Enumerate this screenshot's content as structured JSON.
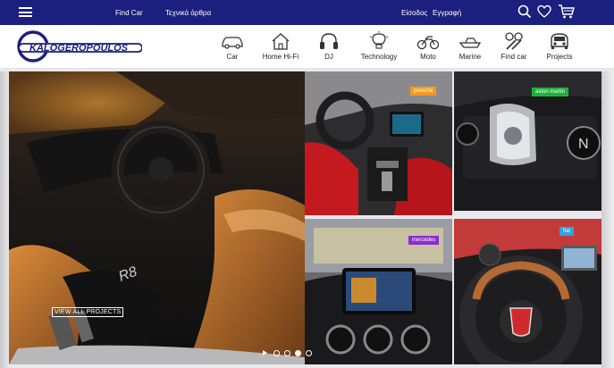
{
  "topbar": {
    "find_car": "Find Car",
    "articles": "Τεχνικά άρθρα",
    "login": "Είσοδος",
    "register": "Εγγραφή"
  },
  "logo": {
    "text": "KALOGEROPOULOS"
  },
  "nav": [
    {
      "label": "Car",
      "icon": "car-icon"
    },
    {
      "label": "Home Hi-Fi",
      "icon": "home-icon"
    },
    {
      "label": "DJ",
      "icon": "headphones-icon"
    },
    {
      "label": "Technology",
      "icon": "lightbulb-icon"
    },
    {
      "label": "Moto",
      "icon": "motorcycle-icon"
    },
    {
      "label": "Marine",
      "icon": "boat-icon"
    },
    {
      "label": "Find car",
      "icon": "wrench-icon"
    },
    {
      "label": "Projects",
      "icon": "projects-car-icon"
    }
  ],
  "tiles": [
    {
      "tag": "porsche",
      "color": "#f39a1e"
    },
    {
      "tag": "aston martin",
      "color": "#1db33b"
    },
    {
      "tag": "mercedes",
      "color": "#8b2fc9"
    },
    {
      "tag": "fiat",
      "color": "#2ea3e6"
    }
  ],
  "hero": {
    "view_all": "VIEW ALL PROJECTS"
  },
  "slider": {
    "total": 4,
    "active": 3
  },
  "colors": {
    "topbar": "#1b1f7e",
    "accent": "#1b1f7e"
  }
}
